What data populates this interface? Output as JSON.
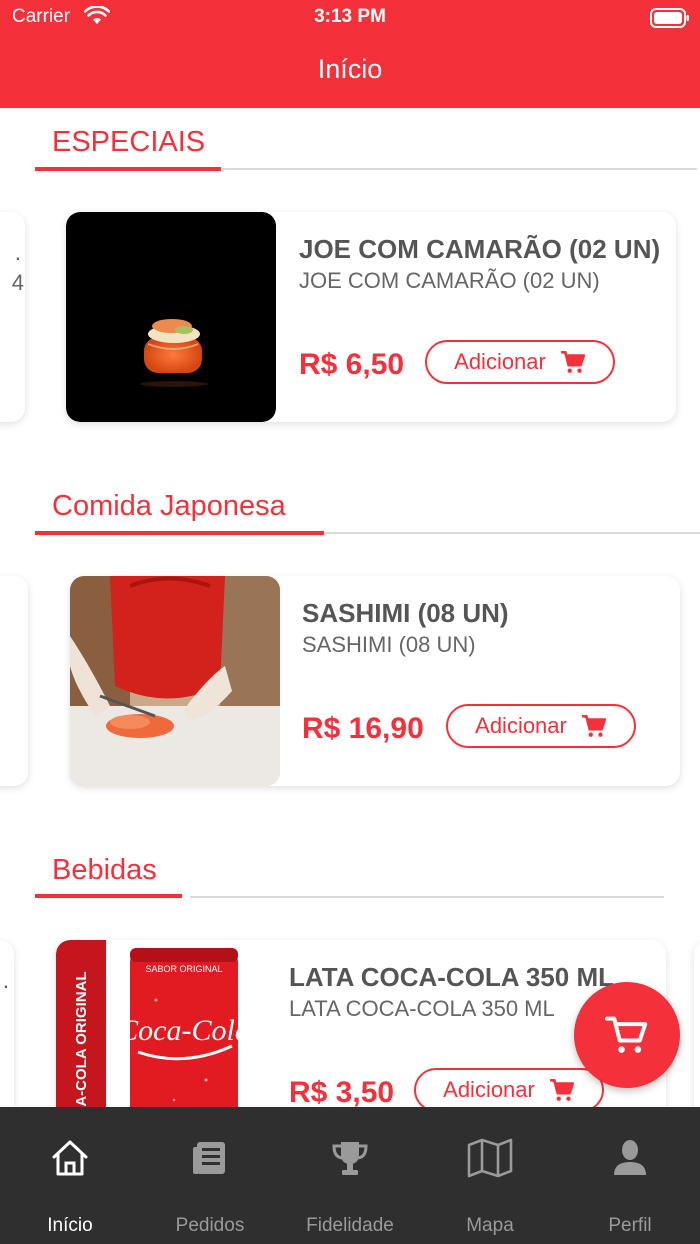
{
  "status_bar": {
    "carrier": "Carrier",
    "time": "3:13 PM"
  },
  "header": {
    "title": "Início"
  },
  "sections": [
    {
      "title": "ESPECIAIS",
      "product": {
        "name": "JOE COM CAMARÃO (02 UN)",
        "description": "JOE COM CAMARÃO (02 UN)",
        "price": "R$ 6,50",
        "add_label": "Adicionar"
      }
    },
    {
      "title": "Comida Japonesa",
      "product": {
        "name": "SASHIMI (08 UN)",
        "description": "SASHIMI (08 UN)",
        "price": "R$ 16,90",
        "add_label": "Adicionar"
      }
    },
    {
      "title": "Bebidas",
      "product": {
        "name": "LATA COCA-COLA 350 ML",
        "description": "LATA COCA-COLA 350 ML",
        "price": "R$ 3,50",
        "add_label": "Adicionar"
      }
    }
  ],
  "peek_left": {
    "text_a": ".",
    "text_b": "4"
  },
  "drink_image_text": {
    "side": "COCA-COLA ORIGINAL",
    "top": "SABOR ORIGINAL",
    "brand": "Coca-Cola"
  },
  "nav": [
    {
      "label": "Início",
      "icon": "home-icon",
      "active": true
    },
    {
      "label": "Pedidos",
      "icon": "orders-icon",
      "active": false
    },
    {
      "label": "Fidelidade",
      "icon": "trophy-icon",
      "active": false
    },
    {
      "label": "Mapa",
      "icon": "map-icon",
      "active": false
    },
    {
      "label": "Perfil",
      "icon": "person-icon",
      "active": false
    }
  ],
  "colors": {
    "brand": "#f4303a",
    "nav_bg": "#2f2f2f",
    "nav_inactive": "#9a9a9a",
    "text_dark": "#555555"
  }
}
